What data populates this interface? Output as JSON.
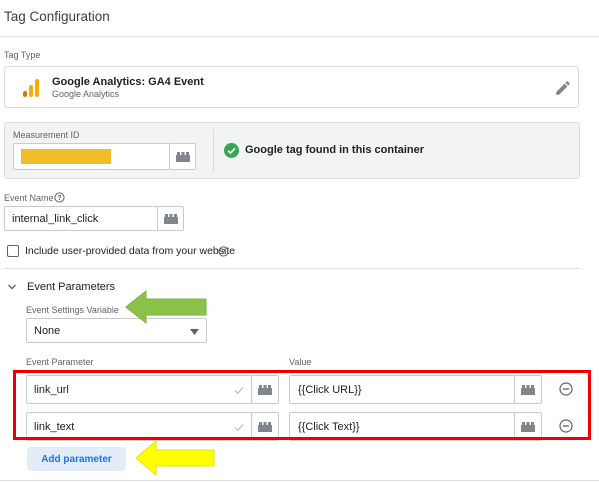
{
  "panel": {
    "title": "Tag Configuration"
  },
  "tag_type": {
    "label": "Tag Type",
    "name": "Google Analytics: GA4 Event",
    "vendor": "Google Analytics",
    "icon": "google-analytics-icon",
    "icon_color": "#f9ab00"
  },
  "measurement": {
    "label": "Measurement ID",
    "value_redacted": true,
    "redaction_color": "#f2bd2b",
    "status": "Google tag found in this container",
    "status_color": "#34a853"
  },
  "event_name": {
    "label": "Event Name",
    "value": "internal_link_click"
  },
  "user_data": {
    "label": "Include user-provided data from your website",
    "checked": false
  },
  "event_parameters": {
    "section_label": "Event Parameters",
    "settings_variable_label": "Event Settings Variable",
    "settings_variable_value": "None",
    "param_col_label": "Event Parameter",
    "value_col_label": "Value",
    "rows": [
      {
        "param": "link_url",
        "value": "{{Click URL}}"
      },
      {
        "param": "link_text",
        "value": "{{Click Text}}"
      }
    ],
    "add_button": "Add parameter"
  },
  "annotations": {
    "green_arrow_color": "#8bc34a",
    "yellow_arrow_color": "#ffff00",
    "highlight_box_color": "#ee0000"
  }
}
